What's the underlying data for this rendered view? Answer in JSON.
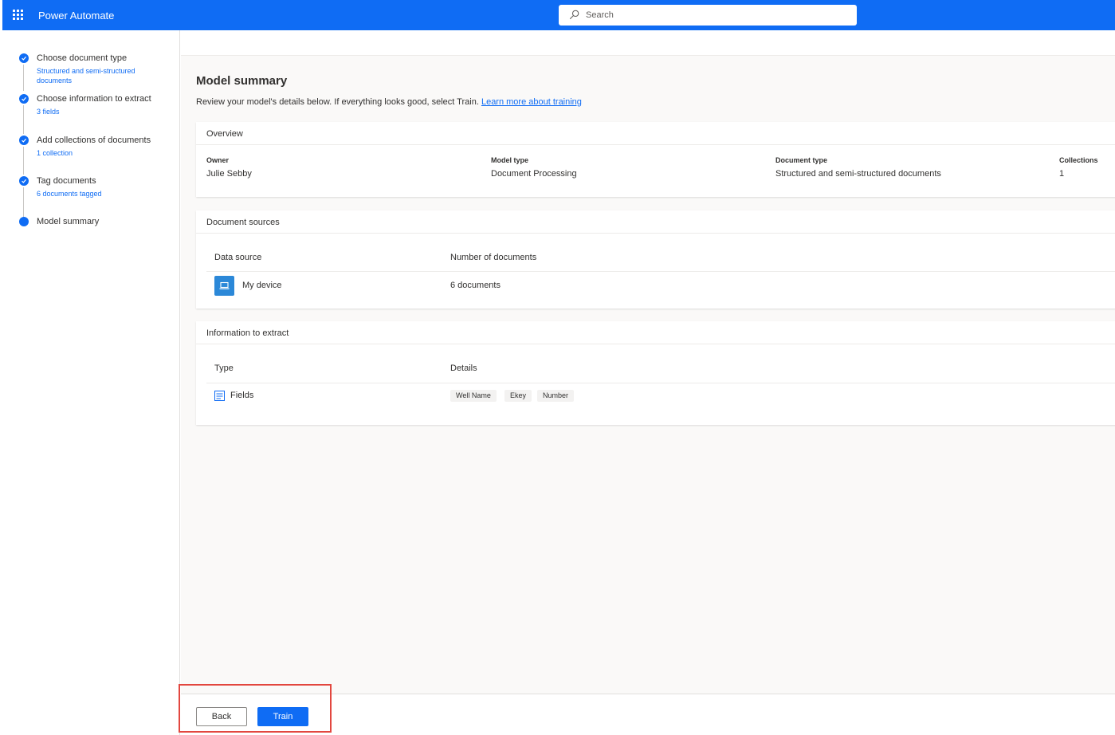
{
  "app": {
    "title": "Power Automate"
  },
  "search": {
    "placeholder": "Search"
  },
  "stepper": {
    "steps": [
      {
        "title": "Choose document type",
        "subtitle": "Structured and semi-structured documents",
        "status": "complete"
      },
      {
        "title": "Choose information to extract",
        "subtitle": "3 fields",
        "status": "complete"
      },
      {
        "title": "Add collections of documents",
        "subtitle": "1 collection",
        "status": "complete"
      },
      {
        "title": "Tag documents",
        "subtitle": "6 documents tagged",
        "status": "complete"
      },
      {
        "title": "Model summary",
        "subtitle": "",
        "status": "current"
      }
    ]
  },
  "page": {
    "title": "Model summary",
    "description": "Review your model's details below. If everything looks good, select Train.",
    "learn_more": "Learn more about training"
  },
  "overview": {
    "heading": "Overview",
    "fields": [
      {
        "label": "Owner",
        "value": "Julie Sebby"
      },
      {
        "label": "Model type",
        "value": "Document Processing"
      },
      {
        "label": "Document type",
        "value": "Structured and semi-structured documents"
      },
      {
        "label": "Collections",
        "value": "1"
      }
    ]
  },
  "sources": {
    "heading": "Document sources",
    "col_source": "Data source",
    "col_count": "Number of documents",
    "rows": [
      {
        "source": "My device",
        "count": "6 documents",
        "icon": "laptop-icon"
      }
    ]
  },
  "extract": {
    "heading": "Information to extract",
    "col_type": "Type",
    "col_details": "Details",
    "rows": [
      {
        "type": "Fields",
        "icon": "fields-icon",
        "details": [
          "Well Name",
          "Ekey",
          "Number"
        ]
      }
    ]
  },
  "footer": {
    "back_label": "Back",
    "train_label": "Train"
  },
  "colors": {
    "brand": "#0f6cf4",
    "highlight": "#e2473f"
  }
}
